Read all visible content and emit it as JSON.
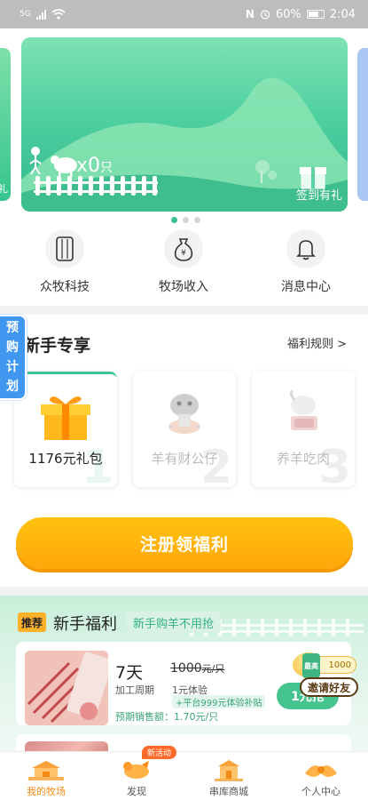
{
  "status_bar": {
    "network": "5G",
    "battery": "60%",
    "time": "2:04"
  },
  "banner": {
    "sheep_count": "x0",
    "sheep_unit": "只",
    "sign_in": "签到有礼",
    "side_left_text": "礼",
    "dots_total": 3,
    "dots_active": 1
  },
  "quick_nav": [
    {
      "label": "众牧科技",
      "icon": "phone-icon"
    },
    {
      "label": "牧场收入",
      "icon": "money-bag-icon"
    },
    {
      "label": "消息中心",
      "icon": "bell-icon"
    }
  ],
  "pre_plan": {
    "chars": [
      "预",
      "购",
      "计",
      "划"
    ]
  },
  "newbie": {
    "title": "新手专享",
    "rules": "福利规则",
    "rules_arrow": ">",
    "cards": [
      {
        "label": "1176元礼包",
        "num": "1"
      },
      {
        "label": "羊有财公仔",
        "num": "2"
      },
      {
        "label": "养羊吃肉",
        "num": "3"
      }
    ],
    "register_button": "注册领福利"
  },
  "benefits": {
    "tag": "推荐",
    "title": "新手福利",
    "subtitle": "新手购羊不用抢",
    "product": {
      "days": "7天",
      "cycle_label": "加工周期",
      "price": "1000",
      "price_unit": "元/只",
      "trial": "1元体验",
      "subsidy": "+平台999元体验补贴",
      "expected": "预期销售额：1.70元/只",
      "button": "1元抢"
    },
    "invite": {
      "badge_tag": "最高",
      "badge_value": "1000",
      "ribbon": "邀请好友"
    }
  },
  "tabbar": {
    "new_badge": "新活动",
    "tabs": [
      {
        "label": "我的牧场",
        "icon": "farm-icon"
      },
      {
        "label": "发现",
        "icon": "discover-icon"
      },
      {
        "label": "串库商城",
        "icon": "mall-icon"
      },
      {
        "label": "个人中心",
        "icon": "profile-icon"
      }
    ]
  },
  "colors": {
    "primary_green": "#3fc491",
    "button_orange": "#ffa70a",
    "pre_plan_blue": "#3f97f0"
  }
}
